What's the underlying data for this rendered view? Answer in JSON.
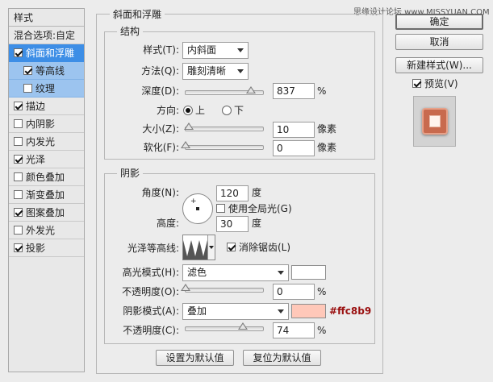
{
  "watermark": "思缘设计论坛 www.MISSYUAN.COM",
  "styles_panel": {
    "title": "样式",
    "blend_options": "混合选项:自定",
    "items": [
      {
        "label": "斜面和浮雕",
        "checked": true
      },
      {
        "label": "等高线",
        "checked": true
      },
      {
        "label": "纹理",
        "checked": false
      },
      {
        "label": "描边",
        "checked": true
      },
      {
        "label": "内阴影",
        "checked": false
      },
      {
        "label": "内发光",
        "checked": false
      },
      {
        "label": "光泽",
        "checked": true
      },
      {
        "label": "颜色叠加",
        "checked": false
      },
      {
        "label": "渐变叠加",
        "checked": false
      },
      {
        "label": "图案叠加",
        "checked": true
      },
      {
        "label": "外发光",
        "checked": false
      },
      {
        "label": "投影",
        "checked": true
      }
    ]
  },
  "bevel": {
    "section_title": "斜面和浮雕",
    "structure": {
      "title": "结构",
      "style_label": "样式(T):",
      "style_value": "内斜面",
      "method_label": "方法(Q):",
      "method_value": "雕刻清晰",
      "depth_label": "深度(D):",
      "depth_value": "837",
      "depth_unit": "%",
      "depth_slider": 0.84,
      "direction_label": "方向:",
      "dir_up": "上",
      "dir_down": "下",
      "size_label": "大小(Z):",
      "size_value": "10",
      "size_unit": "像素",
      "size_slider": 0.04,
      "soften_label": "软化(F):",
      "soften_value": "0",
      "soften_unit": "像素",
      "soften_slider": 0.0
    },
    "shading": {
      "title": "阴影",
      "angle_label": "角度(N):",
      "angle_value": "120",
      "angle_unit": "度",
      "global_light": "使用全局光(G)",
      "global_light_checked": false,
      "altitude_label": "高度:",
      "altitude_value": "30",
      "altitude_unit": "度",
      "gloss_label": "光泽等高线:",
      "antialias": "消除锯齿(L)",
      "antialias_checked": true,
      "highlight_mode_label": "高光模式(H):",
      "highlight_mode": "滤色",
      "highlight_color": "#ffffff",
      "opacity1_label": "不透明度(O):",
      "opacity1_value": "0",
      "opacity1_unit": "%",
      "opacity1_slider": 0.0,
      "shadow_mode_label": "阴影模式(A):",
      "shadow_mode": "叠加",
      "shadow_color": "#ffc8b9",
      "shadow_color_text": "#ffc8b9",
      "opacity2_label": "不透明度(C):",
      "opacity2_value": "74",
      "opacity2_unit": "%",
      "opacity2_slider": 0.74
    },
    "make_default": "设置为默认值",
    "reset_default": "复位为默认值"
  },
  "right": {
    "ok": "确定",
    "cancel": "取消",
    "new_style": "新建样式(W)...",
    "preview": "预览(V)",
    "preview_checked": true
  }
}
